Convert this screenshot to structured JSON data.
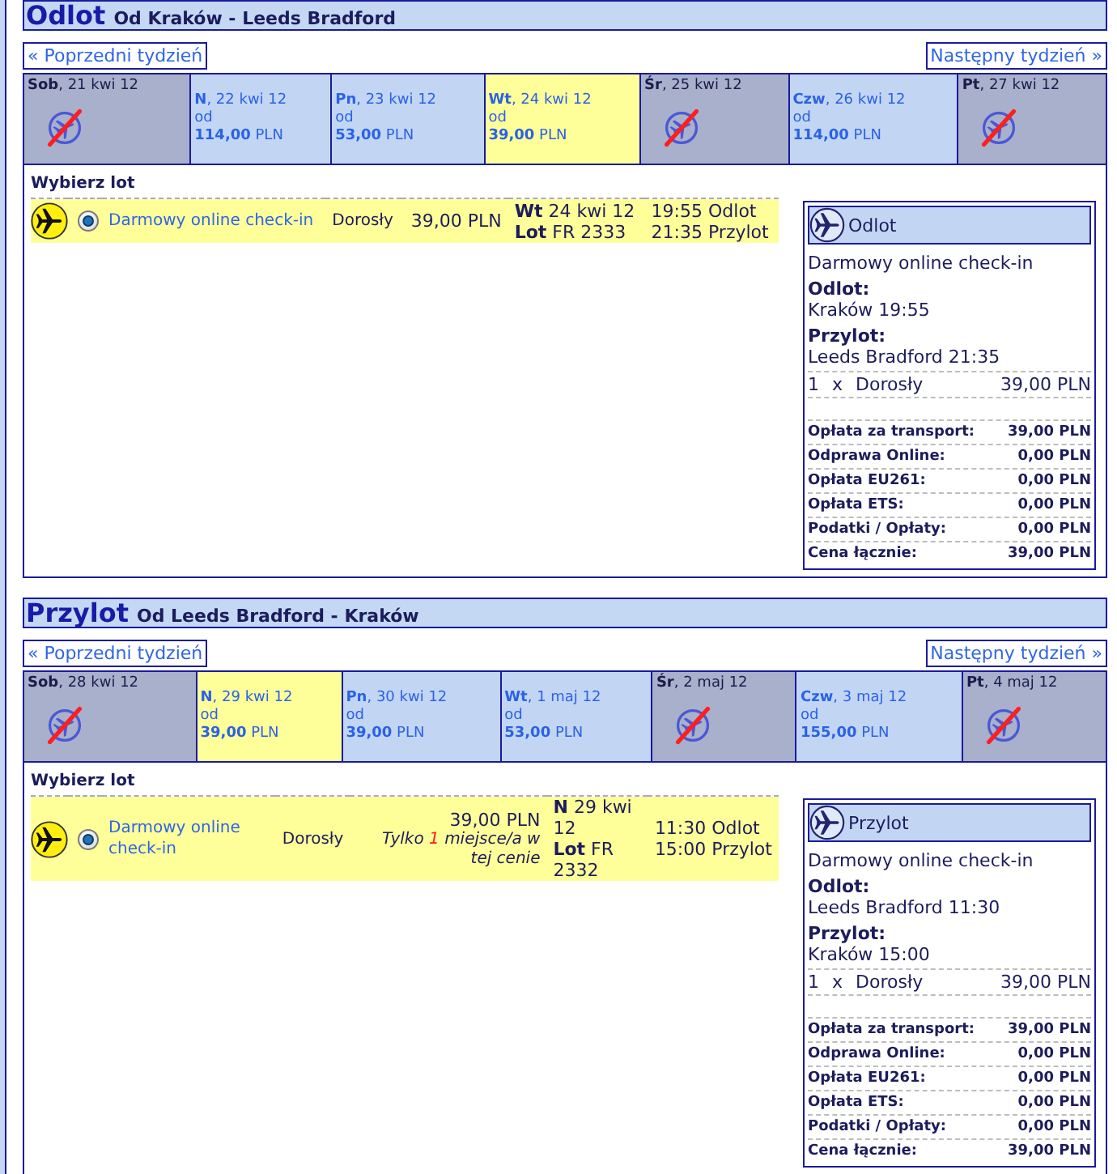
{
  "sections": [
    {
      "title": "Odlot",
      "route": "Od Kraków - Leeds Bradford",
      "prev_week": "« Poprzedni tydzień",
      "next_week": "Następny tydzień »",
      "days": [
        {
          "label": "**Sob**, 21 kwi 12",
          "available": false,
          "selected": false
        },
        {
          "label": "**N**, 22 kwi 12",
          "available": true,
          "selected": false,
          "from": "od",
          "price": "**114,00** PLN"
        },
        {
          "label": "**Pn**, 23 kwi 12",
          "available": true,
          "selected": false,
          "from": "od",
          "price": "**53,00** PLN"
        },
        {
          "label": "**Wt**, 24 kwi 12",
          "available": true,
          "selected": true,
          "from": "od",
          "price": "**39,00** PLN"
        },
        {
          "label": "**Śr**, 25 kwi 12",
          "available": false,
          "selected": false
        },
        {
          "label": "**Czw**, 26 kwi 12",
          "available": true,
          "selected": false,
          "from": "od",
          "price": "**114,00** PLN"
        },
        {
          "label": "**Pt**, 27 kwi 12",
          "available": false,
          "selected": false
        }
      ],
      "choose_label": "Wybierz lot",
      "flights": [
        {
          "selected": true,
          "fare": "Darmowy online check-in",
          "passenger": "Dorosły",
          "price": "39,00 PLN",
          "date": "**Wt** 24 kwi 12",
          "flight": "**Lot** FR 2333",
          "departure": "19:55 Odlot",
          "arrival": "21:35 Przylot"
        }
      ],
      "summary": {
        "title": "Odlot",
        "fare": "Darmowy online check-in",
        "departure_label": "Odlot:",
        "departure": "Kraków 19:55",
        "arrival_label": "Przylot:",
        "arrival": "Leeds Bradford 21:35",
        "passengers": [
          {
            "count": "1",
            "times": "x",
            "type": "Dorosły",
            "amount": "39,00 PLN"
          }
        ],
        "fees": [
          {
            "label": "Opłata za transport:",
            "amount": "39,00 PLN"
          },
          {
            "label": "Odprawa Online:",
            "amount": "0,00 PLN"
          },
          {
            "label": "Opłata EU261:",
            "amount": "0,00 PLN"
          },
          {
            "label": "Opłata ETS:",
            "amount": "0,00 PLN"
          },
          {
            "label": "Podatki / Opłaty:",
            "amount": "0,00 PLN"
          },
          {
            "label": "Cena łącznie:",
            "amount": "39,00 PLN"
          }
        ]
      }
    },
    {
      "title": "Przylot",
      "route": "Od Leeds Bradford - Kraków",
      "prev_week": "« Poprzedni tydzień",
      "next_week": "Następny tydzień »",
      "days": [
        {
          "label": "**Sob**, 28 kwi 12",
          "available": false,
          "selected": false
        },
        {
          "label": "**N**, 29 kwi 12",
          "available": true,
          "selected": true,
          "from": "od",
          "price": "**39,00** PLN"
        },
        {
          "label": "**Pn**, 30 kwi 12",
          "available": true,
          "selected": false,
          "from": "od",
          "price": "**39,00** PLN"
        },
        {
          "label": "**Wt**, 1 maj 12",
          "available": true,
          "selected": false,
          "from": "od",
          "price": "**53,00** PLN"
        },
        {
          "label": "**Śr**, 2 maj 12",
          "available": false,
          "selected": false
        },
        {
          "label": "**Czw**, 3 maj 12",
          "available": true,
          "selected": false,
          "from": "od",
          "price": "**155,00** PLN"
        },
        {
          "label": "**Pt**, 4 maj 12",
          "available": false,
          "selected": false
        }
      ],
      "choose_label": "Wybierz lot",
      "flights": [
        {
          "selected": true,
          "fare": "Darmowy online check-in",
          "passenger": "Dorosły",
          "price": "39,00 PLN",
          "note": {
            "before": "Tylko",
            "count": "1",
            "after": "miejsce/a w tej cenie"
          },
          "date": "**N** 29 kwi 12",
          "flight": "**Lot** FR 2332",
          "departure": "11:30 Odlot",
          "arrival": "15:00 Przylot"
        }
      ],
      "summary": {
        "title": "Przylot",
        "fare": "Darmowy online check-in",
        "departure_label": "Odlot:",
        "departure": "Leeds Bradford 11:30",
        "arrival_label": "Przylot:",
        "arrival": "Kraków 15:00",
        "passengers": [
          {
            "count": "1",
            "times": "x",
            "type": "Dorosły",
            "amount": "39,00 PLN"
          }
        ],
        "fees": [
          {
            "label": "Opłata za transport:",
            "amount": "39,00 PLN"
          },
          {
            "label": "Odprawa Online:",
            "amount": "0,00 PLN"
          },
          {
            "label": "Opłata EU261:",
            "amount": "0,00 PLN"
          },
          {
            "label": "Opłata ETS:",
            "amount": "0,00 PLN"
          },
          {
            "label": "Podatki / Opłaty:",
            "amount": "0,00 PLN"
          },
          {
            "label": "Cena łącznie:",
            "amount": "39,00 PLN"
          }
        ]
      }
    }
  ]
}
